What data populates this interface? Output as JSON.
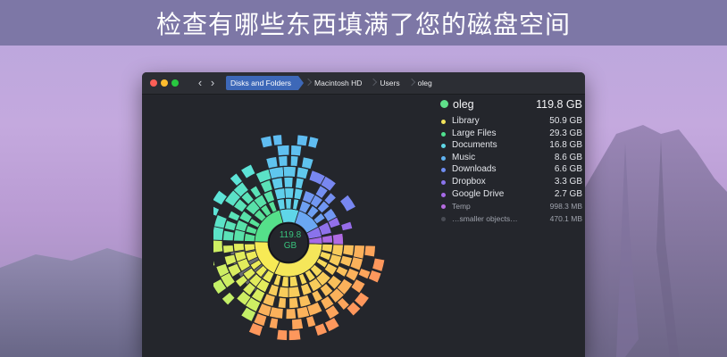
{
  "banner": {
    "title": "检查有哪些东西填满了您的磁盘空间"
  },
  "window": {
    "breadcrumbs": [
      "Disks and Folders",
      "Macintosh HD",
      "Users",
      "oleg"
    ],
    "nav": {
      "back": "‹",
      "forward": "›"
    }
  },
  "center": {
    "line1": "119.8",
    "line2": "GB"
  },
  "panel": {
    "name": "oleg",
    "size": "119.8 GB",
    "color": "#5fe08a",
    "items": [
      {
        "label": "Library",
        "size": "50.9 GB",
        "color": "#f2e25b"
      },
      {
        "label": "Large Files",
        "size": "29.3 GB",
        "color": "#4fe08f"
      },
      {
        "label": "Documents",
        "size": "16.8 GB",
        "color": "#5fd7e6"
      },
      {
        "label": "Music",
        "size": "8.6 GB",
        "color": "#5fb2f0"
      },
      {
        "label": "Downloads",
        "size": "6.6 GB",
        "color": "#6f8df2"
      },
      {
        "label": "Dropbox",
        "size": "3.3 GB",
        "color": "#8a73ec"
      },
      {
        "label": "Google Drive",
        "size": "2.7 GB",
        "color": "#a66ae8"
      },
      {
        "label": "Temp",
        "size": "998.3 MB",
        "color": "#b66be0"
      },
      {
        "label": "…smaller objects…",
        "size": "470.1 MB",
        "color": "#4a4d55"
      }
    ]
  }
}
